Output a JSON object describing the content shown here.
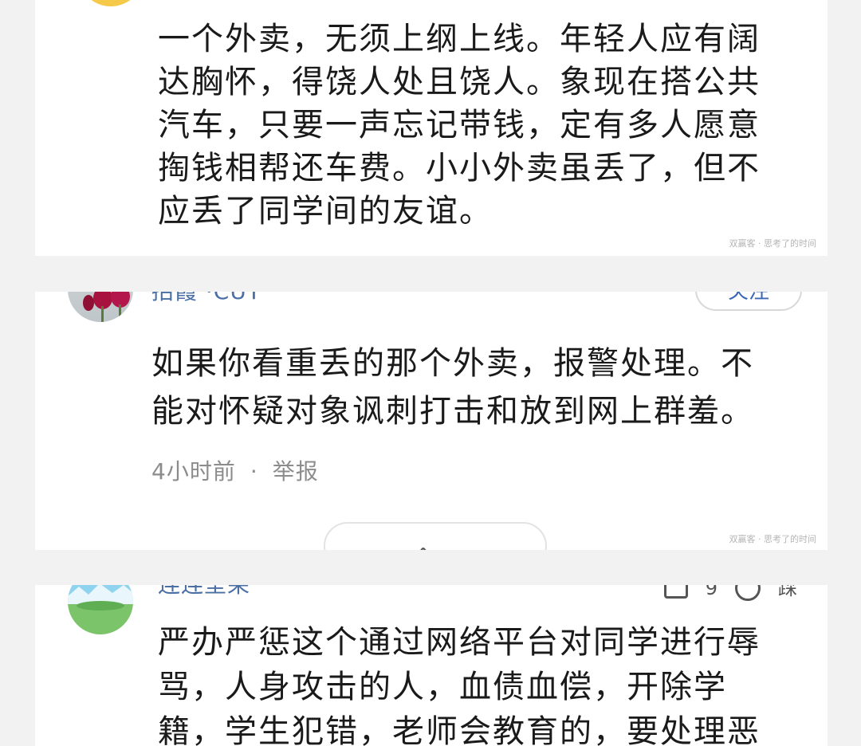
{
  "comments": [
    {
      "text_lines": [
        "一个外卖，无须上纲上线。年轻人应有阔",
        "达胸怀，得饶人处且饶人。象现在搭公共",
        "汽车，只要一声忘记带钱，定有多人愿意",
        "掏钱相帮还车费。小小外卖虽丢了，但不",
        "应丢了同学间的友谊。"
      ],
      "watermark": "双赢客 · 思考了的时间"
    },
    {
      "username": "招霞 ·CUT",
      "follow_label": "关注",
      "text_lines": [
        "如果你看重丢的那个外卖，报警处理。不",
        "能对怀疑对象讽刺打击和放到网上群羞。"
      ],
      "time": "4小时前",
      "separator": "·",
      "report_label": "举报",
      "expand_glyph": "へ ~",
      "watermark": "双赢客 · 思考了的时间"
    },
    {
      "username": "连连垒呆",
      "like_count": "9",
      "dislike_label": "踩",
      "text_lines": [
        "严办严惩这个通过网络平台对同学进行辱",
        "骂，人身攻击的人，血债血偿，开除学",
        "籍，学生犯错，老师会教育的，要处理恶"
      ]
    }
  ],
  "colors": {
    "background": "#f2f2f2",
    "card": "#ffffff",
    "text": "#1a1a1a",
    "meta_text": "#8c8c8c",
    "link": "#3c67b8"
  }
}
